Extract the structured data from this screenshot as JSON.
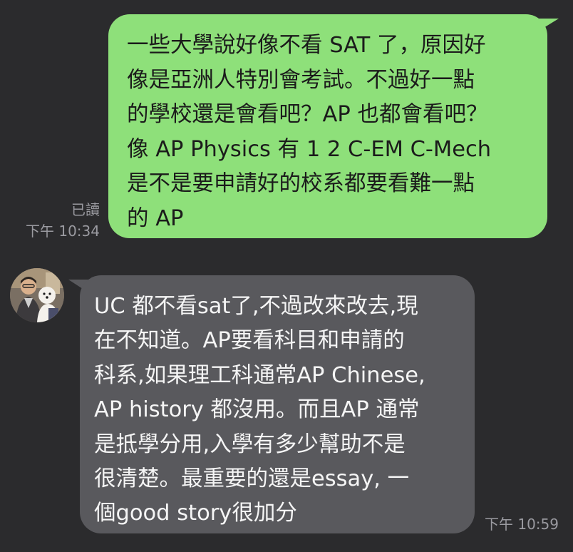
{
  "messages": [
    {
      "direction": "outgoing",
      "text": "一些大學說好像不看 SAT 了，原因好\n像是亞洲人特別會考試。不過好一點\n的學校還是會看吧？AP 也都會看吧？\n像 AP Physics 有 1 2 C-EM C-Mech\n是不是要申請好的校系都要看難一點\n的 AP",
      "read_label": "已讀",
      "time": "下午 10:34",
      "bubble_color": "#8ee07a"
    },
    {
      "direction": "incoming",
      "text": "UC 都不看sat了,不過改來改去,現\n在不知道。AP要看科目和申請的\n科系,如果理工科通常AP Chinese,\nAP history 都沒用。而且AP 通常\n是抵學分用,入學有多少幫助不是\n很清楚。最重要的還是essay, 一\n個good story很加分",
      "time": "下午 10:59",
      "bubble_color": "#59595d"
    }
  ],
  "theme": {
    "background": "#2b2b2d",
    "meta_text": "#9a9aa0"
  }
}
